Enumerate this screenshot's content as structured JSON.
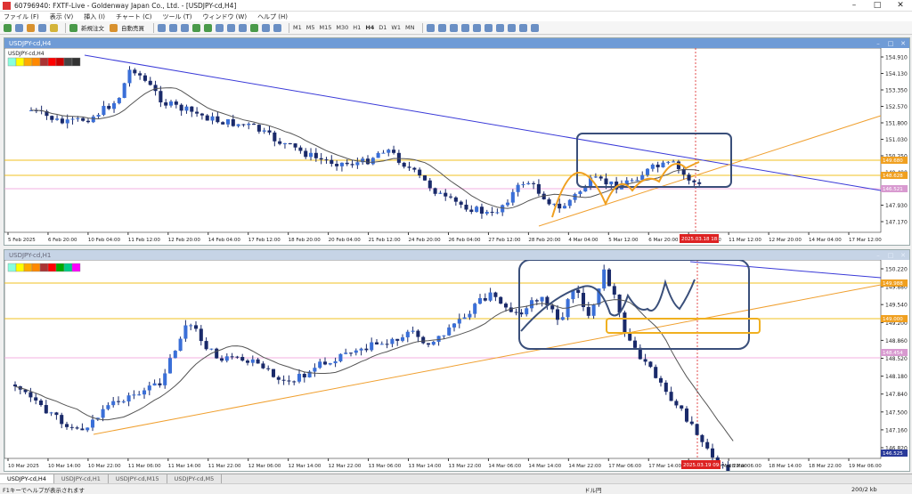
{
  "window": {
    "title": "60796940: FXTF-Live - Goldenway Japan Co., Ltd. - [USDJPY-cd,H4]"
  },
  "menu": [
    "ファイル (F)",
    "表示 (V)",
    "挿入 (I)",
    "チャート (C)",
    "ツール (T)",
    "ウィンドウ (W)",
    "ヘルプ (H)"
  ],
  "toolbar": {
    "new_order": "新規注文",
    "auto_trade": "自動売買",
    "timeframes": [
      "M1",
      "M5",
      "M15",
      "M30",
      "H1",
      "H4",
      "D1",
      "W1",
      "MN"
    ],
    "active_tf": "H4"
  },
  "chart_top": {
    "window_title": "USDJPY-cd,H4",
    "symbol_label": "USDJPY-cd,H4",
    "price_ticks": [
      "154.910",
      "154.130",
      "153.350",
      "152.570",
      "151.800",
      "151.030",
      "150.250",
      "149.490",
      "148.710",
      "147.930",
      "147.170"
    ],
    "current_price": "146.521",
    "hline_tags": [
      "149.680",
      "148.628"
    ],
    "time_labels": [
      "5 Feb 2025",
      "6 Feb 20:00",
      "10 Feb 04:00",
      "11 Feb 12:00",
      "12 Feb 20:00",
      "14 Feb 04:00",
      "17 Feb 12:00",
      "18 Feb 20:00",
      "20 Feb 04:00",
      "21 Feb 12:00",
      "24 Feb 20:00",
      "26 Feb 04:00",
      "27 Feb 12:00",
      "28 Feb 20:00",
      "4 Mar 04:00",
      "5 Mar 12:00",
      "6 Mar 20:00",
      "10 Mar 04:00",
      "11 Mar 12:00",
      "12 Mar 20:00",
      "14 Mar 04:00",
      "17 Mar 12:00"
    ],
    "cursor_label": "2025.03.18 18:00"
  },
  "chart_bottom": {
    "window_title": "USDJPY-cd,H1",
    "price_ticks": [
      "150.220",
      "149.880",
      "149.540",
      "149.200",
      "148.860",
      "148.520",
      "148.180",
      "147.840",
      "147.500",
      "147.160",
      "146.820"
    ],
    "current_price": "146.525",
    "hline_tags": [
      "149.988",
      "149.000",
      "148.454"
    ],
    "time_labels": [
      "10 Mar 2025",
      "10 Mar 14:00",
      "10 Mar 22:00",
      "11 Mar 06:00",
      "11 Mar 14:00",
      "11 Mar 22:00",
      "12 Mar 06:00",
      "12 Mar 14:00",
      "12 Mar 22:00",
      "13 Mar 06:00",
      "13 Mar 14:00",
      "13 Mar 22:00",
      "14 Mar 06:00",
      "14 Mar 14:00",
      "14 Mar 22:00",
      "17 Mar 06:00",
      "17 Mar 14:00",
      "17 Mar 22:00",
      "18 Mar 06:00",
      "18 Mar 14:00",
      "18 Mar 22:00",
      "19 Mar 06:00"
    ],
    "cursor_label": "2025.03.19 09:00",
    "last_label": "Mar 22:00"
  },
  "tabs": [
    "USDJPY-cd,H4",
    "USDJPY-cd,H1",
    "USDJPY-cd,M15",
    "USDJPY-cd,M5"
  ],
  "status": {
    "help": "F1キーでヘルプが表示されます",
    "profile": "ドル円",
    "traffic": "200/2 kb"
  },
  "colors": {
    "up": "#3a6fd8",
    "down": "#1a2a6a",
    "ma": "#555555",
    "trend": "#f0a030",
    "resistance": "#3a3ad8",
    "box": "#3a4f7a",
    "hline": "#f0c020"
  }
}
